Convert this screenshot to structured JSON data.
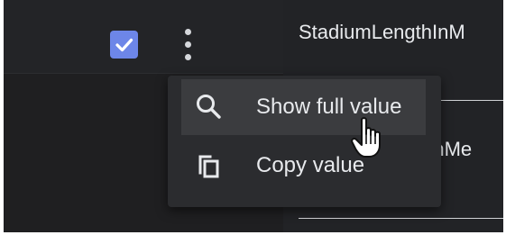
{
  "header": {
    "checkbox": {
      "checked": true,
      "color": "#6d86e8"
    },
    "more_menu_icon": "more-vert-icon"
  },
  "fields": [
    {
      "label": "StadiumLengthInM"
    },
    {
      "label": "hInMe"
    }
  ],
  "context_menu": {
    "items": [
      {
        "label": "Show full value",
        "icon": "search-icon",
        "hovered": true
      },
      {
        "label": "Copy value",
        "icon": "copy-icon",
        "hovered": false
      }
    ]
  },
  "cursor": "hand-pointer-cursor",
  "colors": {
    "background": "#202124",
    "menu_background": "#2b2c2f",
    "menu_hover": "#3b3c3f",
    "text": "#e8eaed",
    "checkbox_accent": "#6d86e8"
  }
}
